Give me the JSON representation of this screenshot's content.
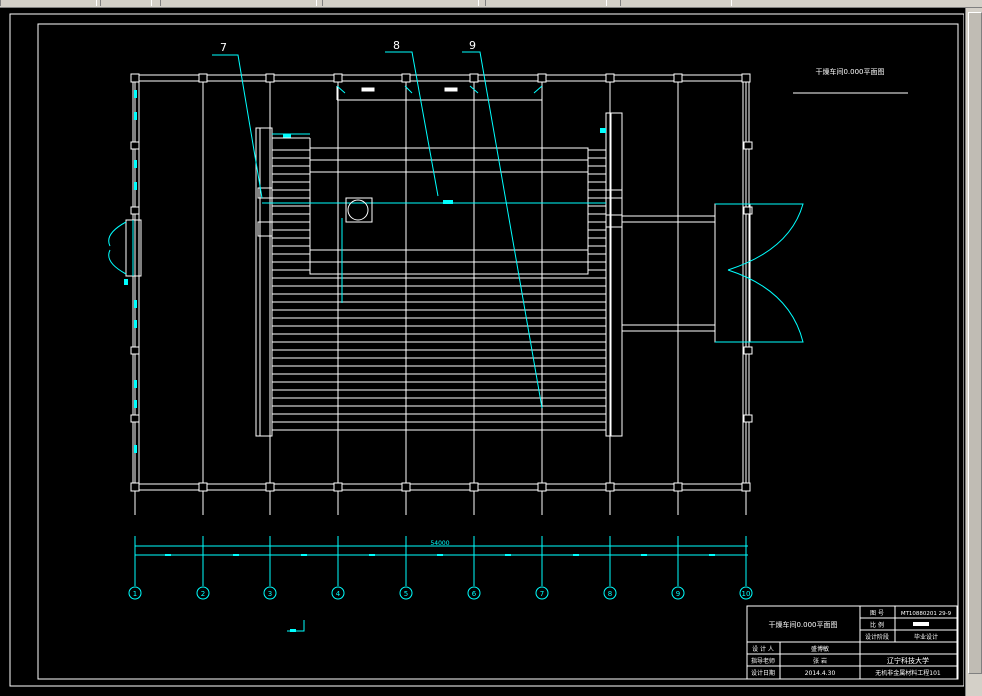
{
  "drawing": {
    "callouts": [
      "7",
      "8",
      "9"
    ],
    "title_top": "干燥车间0.000平面图",
    "overall_dim": "54000",
    "axis_labels": [
      "1",
      "2",
      "3",
      "4",
      "5",
      "6",
      "7",
      "8",
      "9",
      "10"
    ]
  },
  "title_block": {
    "plan_name": "干燥车间0.000平面图",
    "rows": [
      {
        "label": "图  号",
        "value": "MT10880201 29-9"
      },
      {
        "label": "比  例",
        "value": ""
      },
      {
        "label": "设计阶段",
        "value": "毕业设计"
      }
    ],
    "people": [
      {
        "label": "设 计 人",
        "value": "盛博敏"
      },
      {
        "label": "指导老师",
        "value": "张  岩"
      },
      {
        "label": "设计日期",
        "value": "2014.4.30"
      }
    ],
    "university": "辽宁科技大学",
    "class_name": "无机非金属材料工程101"
  },
  "colors": {
    "line": "#ffffff",
    "accent": "#00ffff",
    "background": "#000000"
  }
}
